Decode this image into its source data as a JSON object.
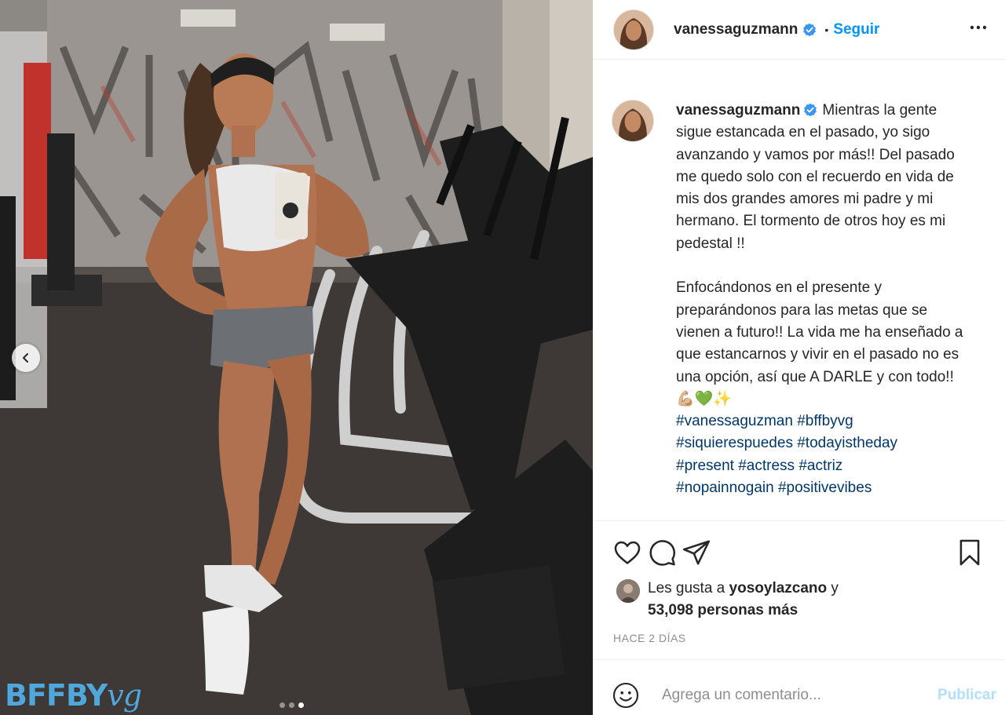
{
  "post": {
    "username": "vanessaguzmann",
    "follow_label": "Seguir",
    "caption": "Mientras la gente sigue estancada en el pasado, yo sigo avanzando y vamos por más!! Del pasado me quedo solo con el recuerdo en vida de mis dos grandes amores mi padre y mi hermano. El tormento de otros hoy es mi pedestal !!\n\nEnfocándonos en el presente y preparándonos para las metas que se vienen a futuro!! La vida me ha enseñado a que estancarnos y vivir en el pasado no es una opción, así que A DARLE y con todo!! 💪🏼💚✨",
    "hashtags": [
      "#vanessaguzman",
      "#bffbyvg",
      "#siquierespuedes",
      "#todayistheday",
      "#present",
      "#actress",
      "#actriz",
      "#nopainnogain",
      "#positivevibes"
    ],
    "likes_prefix": "Les gusta a",
    "liked_by": "yosoylazcano",
    "likes_and": "y",
    "likes_count": "53,098 personas más",
    "timestamp": "HACE 2 DÍAS",
    "comment_placeholder": "Agrega un comentario...",
    "publish_label": "Publicar",
    "watermark": "BFFBY",
    "watermark_script": "vg"
  },
  "carousel": {
    "total": 3,
    "current": 3
  },
  "colors": {
    "accent": "#0095f6",
    "link": "#00376b",
    "muted": "#8e8e8e",
    "publish_disabled": "#b2dffc"
  },
  "icons": [
    "verified-icon",
    "more-icon",
    "heart-icon",
    "comment-icon",
    "share-icon",
    "save-icon",
    "emoji-icon",
    "chevron-left-icon"
  ]
}
